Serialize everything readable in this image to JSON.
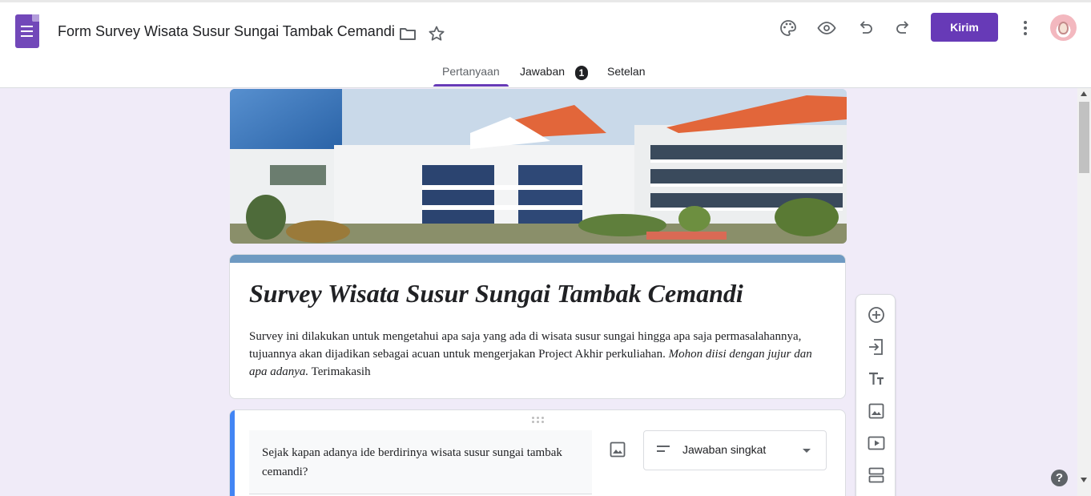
{
  "header": {
    "app_icon": "google-forms-icon",
    "doc_title": "Form Survey Wisata Susur Sungai Tambak Cemandi",
    "folder_icon": "folder-icon",
    "star_icon": "star-icon",
    "toolbar_icons": [
      "palette-icon",
      "eye-icon",
      "undo-icon",
      "redo-icon"
    ],
    "send_label": "Kirim",
    "more_icon": "more-vert-icon",
    "accent_color": "#673ab7"
  },
  "tabs": [
    {
      "label": "Pertanyaan",
      "active": true
    },
    {
      "label": "Jawaban",
      "badge": "1"
    },
    {
      "label": "Setelan"
    }
  ],
  "form": {
    "title": "Survey Wisata Susur Sungai Tambak Cemandi",
    "description_plain": "Survey ini dilakukan untuk mengetahui apa saja yang ada di wisata susur sungai hingga apa saja permasalahannya, tujuannya akan dijadikan sebagai acuan untuk mengerjakan Project Akhir perkuliahan. ",
    "description_italic": "Mohon diisi dengan jujur dan apa adanya.",
    "description_end": " Terimakasih",
    "header_accent_color": "#6f9ac2"
  },
  "question": {
    "text": "Sejak kapan adanya ide berdirinya wisata susur sungai tambak cemandi?",
    "type_label": "Jawaban singkat",
    "type_icon": "short-text-icon",
    "image_icon": "image-icon"
  },
  "side_toolbar": [
    "add-question-icon",
    "import-questions-icon",
    "add-title-icon",
    "add-image-icon",
    "add-video-icon",
    "add-section-icon"
  ],
  "help_label": "?"
}
